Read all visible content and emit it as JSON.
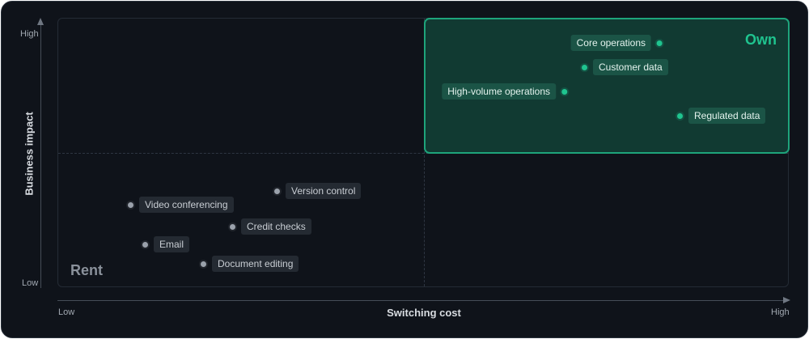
{
  "axes": {
    "x_title": "Switching cost",
    "y_title": "Business impact",
    "x_low": "Low",
    "x_high": "High",
    "y_low": "Low",
    "y_high": "High"
  },
  "quadrants": {
    "own": "Own",
    "rent": "Rent"
  },
  "colors": {
    "own_accent": "#1fc48f",
    "own_fill": "#113a32",
    "background": "#0f131a",
    "rent_dot": "#9aa1ab"
  },
  "points": [
    {
      "id": "core-operations",
      "label": "Core operations",
      "zone": "own",
      "dot_side": "right"
    },
    {
      "id": "customer-data",
      "label": "Customer data",
      "zone": "own",
      "dot_side": "left"
    },
    {
      "id": "high-volume-operations",
      "label": "High-volume operations",
      "zone": "own",
      "dot_side": "right"
    },
    {
      "id": "regulated-data",
      "label": "Regulated data",
      "zone": "own",
      "dot_side": "left"
    },
    {
      "id": "version-control",
      "label": "Version control",
      "zone": "rent",
      "dot_side": "left"
    },
    {
      "id": "video-conferencing",
      "label": "Video conferencing",
      "zone": "rent",
      "dot_side": "left"
    },
    {
      "id": "credit-checks",
      "label": "Credit checks",
      "zone": "rent",
      "dot_side": "left"
    },
    {
      "id": "email",
      "label": "Email",
      "zone": "rent",
      "dot_side": "left"
    },
    {
      "id": "document-editing",
      "label": "Document editing",
      "zone": "rent",
      "dot_side": "left"
    }
  ]
}
